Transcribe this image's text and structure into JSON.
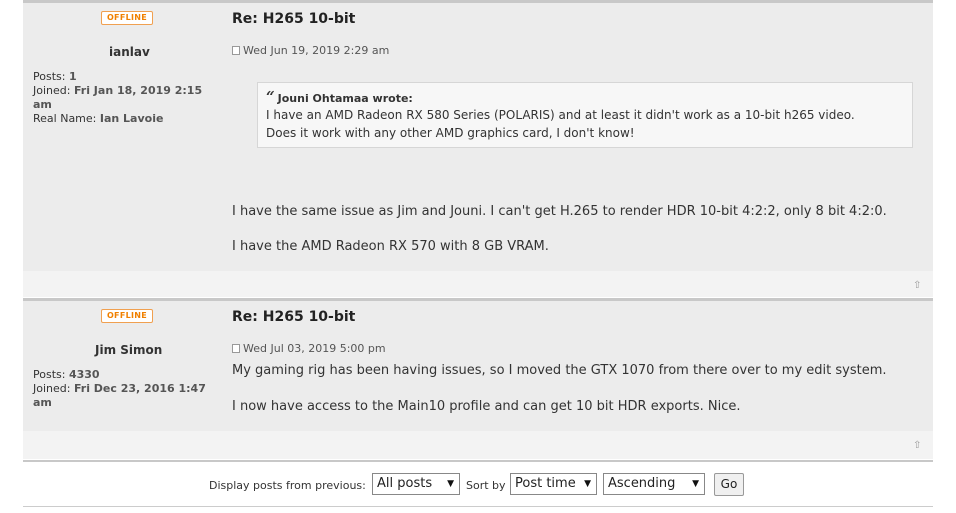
{
  "posts": [
    {
      "status": "OFFLINE",
      "author": "ianlav",
      "profile": {
        "posts_label": "Posts:",
        "posts_value": "1",
        "joined_label": "Joined:",
        "joined_value": "Fri Jan 18, 2019 2:15 am",
        "realname_label": "Real Name:",
        "realname_value": "Ian Lavoie"
      },
      "title": "Re: H265 10-bit",
      "timestamp": "Wed Jun 19, 2019 2:29 am",
      "quote": {
        "author_line": "Jouni Ohtamaa wrote:",
        "lines": [
          "I have an AMD Radeon RX 580 Series (POLARIS) and at least it didn't work as a 10-bit h265 video.",
          "Does it work with any other AMD graphics card, I don't know!"
        ]
      },
      "paragraphs": [
        "I have the same issue as Jim and Jouni. I can't get H.265 to render HDR 10-bit 4:2:2, only 8 bit 4:2:0.",
        "I have the AMD Radeon RX 570 with 8 GB VRAM."
      ]
    },
    {
      "status": "OFFLINE",
      "author": "Jim Simon",
      "profile": {
        "posts_label": "Posts:",
        "posts_value": "4330",
        "joined_label": "Joined:",
        "joined_value": "Fri Dec 23, 2016 1:47 am"
      },
      "title": "Re: H265 10-bit",
      "timestamp": "Wed Jul 03, 2019 5:00 pm",
      "paragraphs": [
        "My gaming rig has been having issues, so I moved the GTX 1070 from there over to my edit system.",
        "I now have access to the Main10 profile and can get 10 bit HDR exports. Nice."
      ]
    }
  ],
  "sortbar": {
    "display_label": "Display posts from previous:",
    "display_value": "All posts",
    "sortby_label": "Sort by",
    "sortby_value": "Post time",
    "order_value": "Ascending",
    "go_label": "Go"
  },
  "icons": {
    "quote": "“",
    "dropdown": "▼",
    "top": "⇧"
  },
  "colors": {
    "offline_badge": "#f08000",
    "post_bg": "#ececec"
  }
}
